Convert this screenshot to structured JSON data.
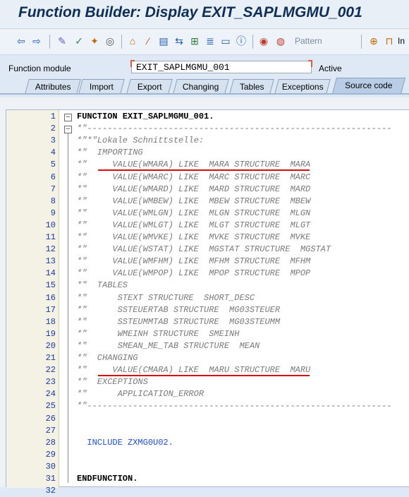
{
  "window": {
    "title": "Function Builder: Display EXIT_SAPLMGMU_001"
  },
  "toolbar": {
    "icons": [
      "back-icon",
      "forward-icon",
      "switch-edit-icon",
      "check-icon",
      "activate-icon",
      "test-icon",
      "where-used-icon",
      "display-object-list-icon",
      "navigation-window-icon",
      "object-list-icon",
      "hierarchy-icon",
      "layout-icon",
      "documentation-icon",
      "breakpoint-icon",
      "session-breakpoint-icon",
      "insert-icon",
      "frame-icon"
    ],
    "pattern_label": "Pattern",
    "truncated_label": "In"
  },
  "function_module": {
    "label": "Function module",
    "value": "EXIT_SAPLMGMU_001",
    "status": "Active"
  },
  "tabs": [
    {
      "label": "Attributes"
    },
    {
      "label": "Import"
    },
    {
      "label": "Export"
    },
    {
      "label": "Changing"
    },
    {
      "label": "Tables"
    },
    {
      "label": "Exceptions"
    },
    {
      "label": "Source code"
    }
  ],
  "colors": {
    "accent": "#0f2e57",
    "underline": "#d60d0d"
  },
  "code": [
    {
      "n": "1",
      "text": "FUNCTION EXIT_SAPLMGMU_001.",
      "style": "kw"
    },
    {
      "n": "2",
      "text": "*\"------------------------------------------------------------",
      "style": "cm"
    },
    {
      "n": "3",
      "text": "*\"*\"Lokale Schnittstelle:",
      "style": "cm"
    },
    {
      "n": "4",
      "text": "*\"  IMPORTING",
      "style": "cm"
    },
    {
      "n": "5",
      "text": "*\"     VALUE(WMARA) LIKE  MARA STRUCTURE  MARA",
      "style": "cm"
    },
    {
      "n": "6",
      "text": "*\"     VALUE(WMARC) LIKE  MARC STRUCTURE  MARC",
      "style": "cm"
    },
    {
      "n": "7",
      "text": "*\"     VALUE(WMARD) LIKE  MARD STRUCTURE  MARD",
      "style": "cm"
    },
    {
      "n": "8",
      "text": "*\"     VALUE(WMBEW) LIKE  MBEW STRUCTURE  MBEW",
      "style": "cm"
    },
    {
      "n": "9",
      "text": "*\"     VALUE(WMLGN) LIKE  MLGN STRUCTURE  MLGN",
      "style": "cm"
    },
    {
      "n": "10",
      "text": "*\"     VALUE(WMLGT) LIKE  MLGT STRUCTURE  MLGT",
      "style": "cm"
    },
    {
      "n": "11",
      "text": "*\"     VALUE(WMVKE) LIKE  MVKE STRUCTURE  MVKE",
      "style": "cm"
    },
    {
      "n": "12",
      "text": "*\"     VALUE(WSTAT) LIKE  MGSTAT STRUCTURE  MGSTAT",
      "style": "cm"
    },
    {
      "n": "13",
      "text": "*\"     VALUE(WMFHM) LIKE  MFHM STRUCTURE  MFHM",
      "style": "cm"
    },
    {
      "n": "14",
      "text": "*\"     VALUE(WMPOP) LIKE  MPOP STRUCTURE  MPOP",
      "style": "cm"
    },
    {
      "n": "15",
      "text": "*\"  TABLES",
      "style": "cm"
    },
    {
      "n": "16",
      "text": "*\"      STEXT STRUCTURE  SHORT_DESC",
      "style": "cm"
    },
    {
      "n": "17",
      "text": "*\"      SSTEUERTAB STRUCTURE  MG03STEUER",
      "style": "cm"
    },
    {
      "n": "18",
      "text": "*\"      SSTEUMMTAB STRUCTURE  MG03STEUMM",
      "style": "cm"
    },
    {
      "n": "19",
      "text": "*\"      WMEINH STRUCTURE  SMEINH",
      "style": "cm"
    },
    {
      "n": "20",
      "text": "*\"      SMEAN_ME_TAB STRUCTURE  MEAN",
      "style": "cm"
    },
    {
      "n": "21",
      "text": "*\"  CHANGING",
      "style": "cm"
    },
    {
      "n": "22",
      "text": "*\"     VALUE(CMARA) LIKE  MARU STRUCTURE  MARU",
      "style": "cm"
    },
    {
      "n": "23",
      "text": "*\"  EXCEPTIONS",
      "style": "cm"
    },
    {
      "n": "24",
      "text": "*\"      APPLICATION_ERROR",
      "style": "cm"
    },
    {
      "n": "25",
      "text": "*\"------------------------------------------------------------",
      "style": "cm"
    },
    {
      "n": "26",
      "text": "",
      "style": "plain"
    },
    {
      "n": "27",
      "text": "",
      "style": "plain"
    },
    {
      "n": "28",
      "text": "  INCLUDE ZXMG0U02.",
      "style": "st"
    },
    {
      "n": "29",
      "text": "",
      "style": "plain"
    },
    {
      "n": "30",
      "text": "",
      "style": "plain"
    },
    {
      "n": "31",
      "text": "ENDFUNCTION.",
      "style": "kw"
    },
    {
      "n": "32",
      "text": "",
      "style": "plain"
    }
  ]
}
